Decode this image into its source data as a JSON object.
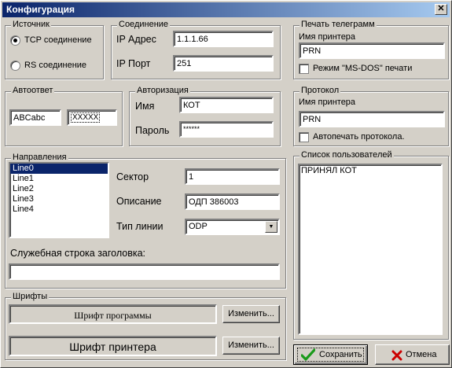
{
  "window": {
    "title": "Конфигурация",
    "close_glyph": "✕"
  },
  "source": {
    "legend": "Источник",
    "tcp_label": "TCP соединение",
    "rs_label": "RS соединение",
    "selected": "tcp"
  },
  "connection": {
    "legend": "Соединение",
    "ip_address_label": "IP Адрес",
    "ip_address_value": "1.1.1.66",
    "ip_port_label": "IP Порт",
    "ip_port_value": "251"
  },
  "telegram_print": {
    "legend": "Печать телеграмм",
    "printer_name_label": "Имя принтера",
    "printer_name_value": "PRN",
    "msdos_mode_label": "Режим \"MS-DOS\" печати"
  },
  "autoanswer": {
    "legend": "Автоответ",
    "value1": "ABCabc",
    "value2": "XXXXX"
  },
  "authorization": {
    "legend": "Авторизация",
    "name_label": "Имя",
    "name_value": "КОТ",
    "password_label": "Пароль",
    "password_value": "******"
  },
  "protocol": {
    "legend": "Протокол",
    "printer_name_label": "Имя принтера",
    "printer_name_value": "PRN",
    "autoprint_label": "Автопечать протокола."
  },
  "directions": {
    "legend": "Направления",
    "lines": [
      "Line0",
      "Line1",
      "Line2",
      "Line3",
      "Line4"
    ],
    "selected_index": 0,
    "sector_label": "Сектор",
    "sector_value": "1",
    "description_label": "Описание",
    "description_value": "ОДП 386003",
    "line_type_label": "Тип линии",
    "line_type_value": "ODP",
    "header_line_label": "Служебная строка заголовка:",
    "header_line_value": ""
  },
  "users": {
    "legend": "Список пользователей",
    "items": [
      "ПРИНЯЛ КОТ"
    ]
  },
  "fonts": {
    "legend": "Шрифты",
    "program_font_label": "Шрифт программы",
    "printer_font_label": "Шрифт принтера",
    "change_label": "Изменить..."
  },
  "actions": {
    "save_label": "Сохранить",
    "cancel_label": "Отмена"
  },
  "colors": {
    "titlebar_start": "#0a246a",
    "titlebar_end": "#a6caf0",
    "face": "#d4d0c8",
    "selection": "#0a246a",
    "save_check": "#1a9a1a",
    "cancel_x": "#cc0000"
  }
}
